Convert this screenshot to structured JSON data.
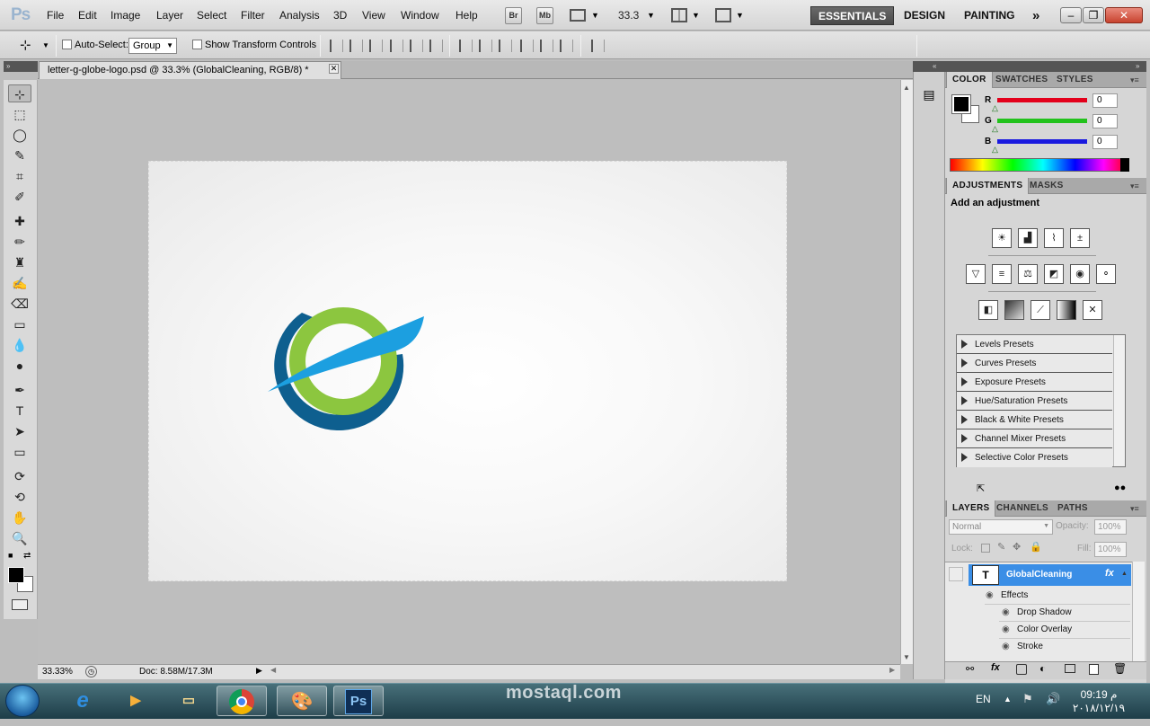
{
  "app": {
    "logo": "Ps"
  },
  "menu": {
    "items": [
      "File",
      "Edit",
      "Image",
      "Layer",
      "Select",
      "Filter",
      "Analysis",
      "3D",
      "View",
      "Window",
      "Help"
    ]
  },
  "appbar": {
    "br": "Br",
    "mb": "Mb",
    "zoom": "33.3"
  },
  "workspaces": {
    "essentials": "ESSENTIALS",
    "design": "DESIGN",
    "painting": "PAINTING",
    "more": "»"
  },
  "window_controls": {
    "minimize": "–",
    "restore": "❐",
    "close": "✕"
  },
  "options": {
    "auto_select": "Auto-Select:",
    "auto_select_value": "Group",
    "show_transform": "Show Transform Controls"
  },
  "document": {
    "tab_title": "letter-g-globe-logo.psd @ 33.3% (GlobalCleaning, RGB/8) *",
    "close": "✕",
    "zoom_status": "33.33%",
    "doc_status": "Doc: 8.58M/17.3M"
  },
  "color_panel": {
    "tabs": [
      "COLOR",
      "SWATCHES",
      "STYLES"
    ],
    "channels": [
      {
        "name": "R",
        "value": "0",
        "color": "#e3001b"
      },
      {
        "name": "G",
        "value": "0",
        "color": "#22c21c"
      },
      {
        "name": "B",
        "value": "0",
        "color": "#1a1adf"
      }
    ]
  },
  "adjustments_panel": {
    "tabs": [
      "ADJUSTMENTS",
      "MASKS"
    ],
    "heading": "Add an adjustment",
    "presets": [
      "Levels Presets",
      "Curves Presets",
      "Exposure Presets",
      "Hue/Saturation Presets",
      "Black & White Presets",
      "Channel Mixer Presets",
      "Selective Color Presets"
    ]
  },
  "layers_panel": {
    "tabs": [
      "LAYERS",
      "CHANNELS",
      "PATHS"
    ],
    "blend_mode": "Normal",
    "opacity_label": "Opacity:",
    "opacity": "100%",
    "lock_label": "Lock:",
    "fill_label": "Fill:",
    "fill": "100%",
    "layer_name": "GlobalCleaning",
    "layer_type": "T",
    "fx": "fx",
    "effects_label": "Effects",
    "effects": [
      "Drop Shadow",
      "Color Overlay",
      "Stroke"
    ]
  },
  "taskbar": {
    "watermark": "mostaql.com",
    "lang": "EN",
    "time": "09:19 م",
    "date": "٢٠١٨/١٢/١٩"
  },
  "logo_colors": {
    "green": "#8cc63f",
    "blue": "#1c9fe0",
    "navy": "#0e5f8f"
  }
}
